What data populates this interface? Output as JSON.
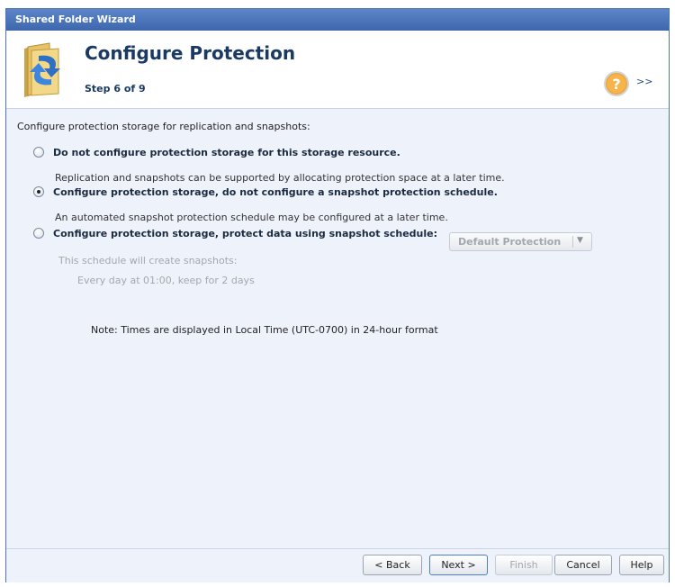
{
  "window": {
    "title": "Shared Folder Wizard"
  },
  "header": {
    "title": "Configure Protection",
    "step": "Step 6 of 9",
    "expand_label": ">>"
  },
  "content": {
    "intro": "Configure protection storage for replication and snapshots:",
    "options": [
      {
        "label": "Do not configure protection storage for this storage resource.",
        "description": "Replication and snapshots can be supported by allocating protection space at a later time.",
        "selected": false
      },
      {
        "label": "Configure protection storage, do not configure a snapshot protection schedule.",
        "description": "An automated snapshot protection schedule may be configured at a later time.",
        "selected": true
      },
      {
        "label": "Configure protection storage, protect data using snapshot schedule:",
        "selected": false
      }
    ],
    "schedule_select": {
      "value": "Default Protection"
    },
    "schedule_info": "This schedule will create snapshots:",
    "schedule_detail": "Every day at 01:00, keep for 2 days",
    "note": "Note: Times are displayed in Local Time (UTC-0700) in 24-hour format"
  },
  "buttons": {
    "back": "< Back",
    "next": "Next >",
    "finish": "Finish",
    "cancel": "Cancel",
    "help": "Help"
  },
  "colors": {
    "titlebar": "#3d66ad",
    "heading": "#1b3a63",
    "panel": "#eef3fb"
  },
  "icons": [
    "folder-wizard-icon",
    "help-icon",
    "radio-button",
    "dropdown-arrow-icon"
  ]
}
